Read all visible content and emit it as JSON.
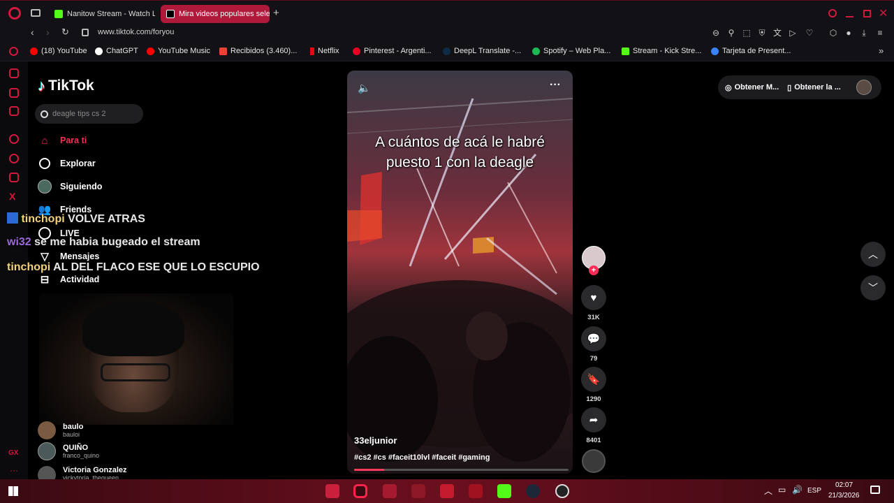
{
  "browser": {
    "tabs": [
      {
        "label": "Nanitow Stream - Watch Li",
        "active": false
      },
      {
        "label": "Mira videos populares sele",
        "active": true
      }
    ],
    "new_tab_label": "+",
    "url": "www.tiktok.com/foryou",
    "bookmarks": [
      {
        "label": "(18) YouTube",
        "color": "#ff0000"
      },
      {
        "label": "ChatGPT",
        "color": "#ffffff"
      },
      {
        "label": "YouTube Music",
        "color": "#ff0000"
      },
      {
        "label": "Recibidos (3.460)...",
        "color": "#ea4335"
      },
      {
        "label": "Netflix",
        "color": "#e50914"
      },
      {
        "label": "Pinterest - Argenti...",
        "color": "#e60023"
      },
      {
        "label": "DeepL Translate -...",
        "color": "#0f2b46"
      },
      {
        "label": "Spotify – Web Pla...",
        "color": "#1db954"
      },
      {
        "label": "Stream - Kick Stre...",
        "color": "#53fc18"
      },
      {
        "label": "Tarjeta de Present...",
        "color": "#3b82f6"
      }
    ]
  },
  "tiktok": {
    "logo": "TikTok",
    "search_placeholder": "deagle tips cs 2",
    "nav": [
      {
        "label": "Para ti",
        "active": true
      },
      {
        "label": "Explorar",
        "active": false
      },
      {
        "label": "Siguiendo",
        "active": false
      },
      {
        "label": "Friends",
        "active": false
      },
      {
        "label": "LIVE",
        "active": false
      },
      {
        "label": "Mensajes",
        "active": false
      },
      {
        "label": "Actividad",
        "active": false
      }
    ],
    "following_accounts": [
      {
        "name": "baulo",
        "handle": "bauloi"
      },
      {
        "name": "QUIÑO",
        "handle": "franco_quino"
      },
      {
        "name": "Victoria Gonzalez",
        "handle": "vickytoria_thequeen"
      }
    ],
    "top_right": {
      "btn1": "Obtener M...",
      "btn2": "Obtener la ..."
    },
    "video": {
      "caption": "A cuántos de acá le habré puesto 1 con la deagle",
      "username": "33eljunior",
      "hashtags": "#cs2 #cs #faceit10lvl #faceit #gaming",
      "progress": 0.14,
      "likes": "31K",
      "comments": "79",
      "saves": "1290",
      "shares": "8401"
    }
  },
  "chat_overlay": [
    {
      "user": "tinchopi",
      "message": "VOLVE ATRAS"
    },
    {
      "user": "wi32",
      "message": "se me habia bugeado el stream"
    },
    {
      "user": "tinchopi",
      "message": "AL DEL FLACO ESE QUE LO ESCUPIO"
    }
  ],
  "taskbar": {
    "lang": "ESP",
    "time": "02:07",
    "date": "21/3/2026"
  },
  "colors": {
    "accent": "#fe2c55",
    "opera_red": "#d4173e"
  }
}
